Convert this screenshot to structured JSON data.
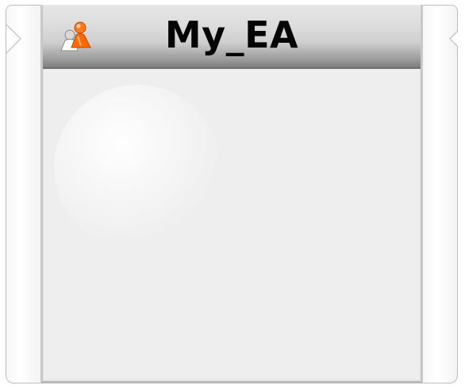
{
  "window": {
    "title": "My_EA"
  },
  "header": {
    "icon": "user-avatar-icon",
    "accent_color": "#ff6a00"
  }
}
